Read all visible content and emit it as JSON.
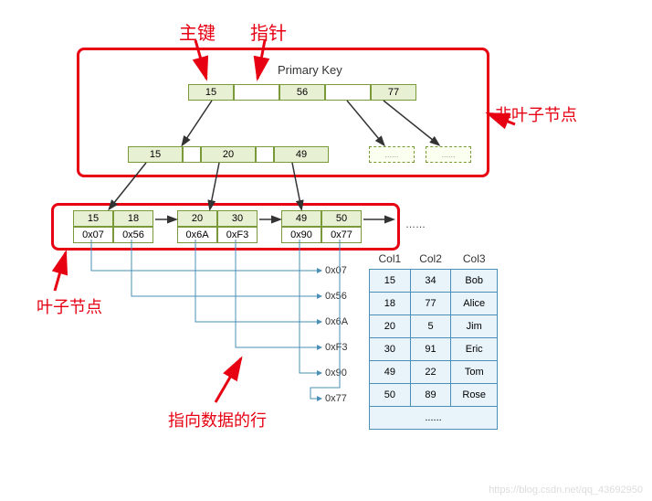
{
  "labels": {
    "primary_key_cn": "主键",
    "pointer_cn": "指针",
    "primary_key_en": "Primary Key",
    "non_leaf": "非叶子节点",
    "leaf": "叶子节点",
    "row_pointer": "指向数据的行",
    "ellipsis": "……",
    "dash": "......"
  },
  "root": {
    "keys": [
      "15",
      "56",
      "77"
    ]
  },
  "level2": {
    "keys": [
      "15",
      "20",
      "49"
    ]
  },
  "leaves": [
    {
      "keys": [
        "15",
        "18"
      ],
      "ptrs": [
        "0x07",
        "0x56"
      ]
    },
    {
      "keys": [
        "20",
        "30"
      ],
      "ptrs": [
        "0x6A",
        "0xF3"
      ]
    },
    {
      "keys": [
        "49",
        "50"
      ],
      "ptrs": [
        "0x90",
        "0x77"
      ]
    }
  ],
  "addresses": [
    "0x07",
    "0x56",
    "0x6A",
    "0xF3",
    "0x90",
    "0x77"
  ],
  "table": {
    "headers": [
      "Col1",
      "Col2",
      "Col3"
    ],
    "rows": [
      [
        "15",
        "34",
        "Bob"
      ],
      [
        "18",
        "77",
        "Alice"
      ],
      [
        "20",
        "5",
        "Jim"
      ],
      [
        "30",
        "91",
        "Eric"
      ],
      [
        "49",
        "22",
        "Tom"
      ],
      [
        "50",
        "89",
        "Rose"
      ]
    ]
  },
  "watermark": "https://blog.csdn.net/qq_43692950"
}
